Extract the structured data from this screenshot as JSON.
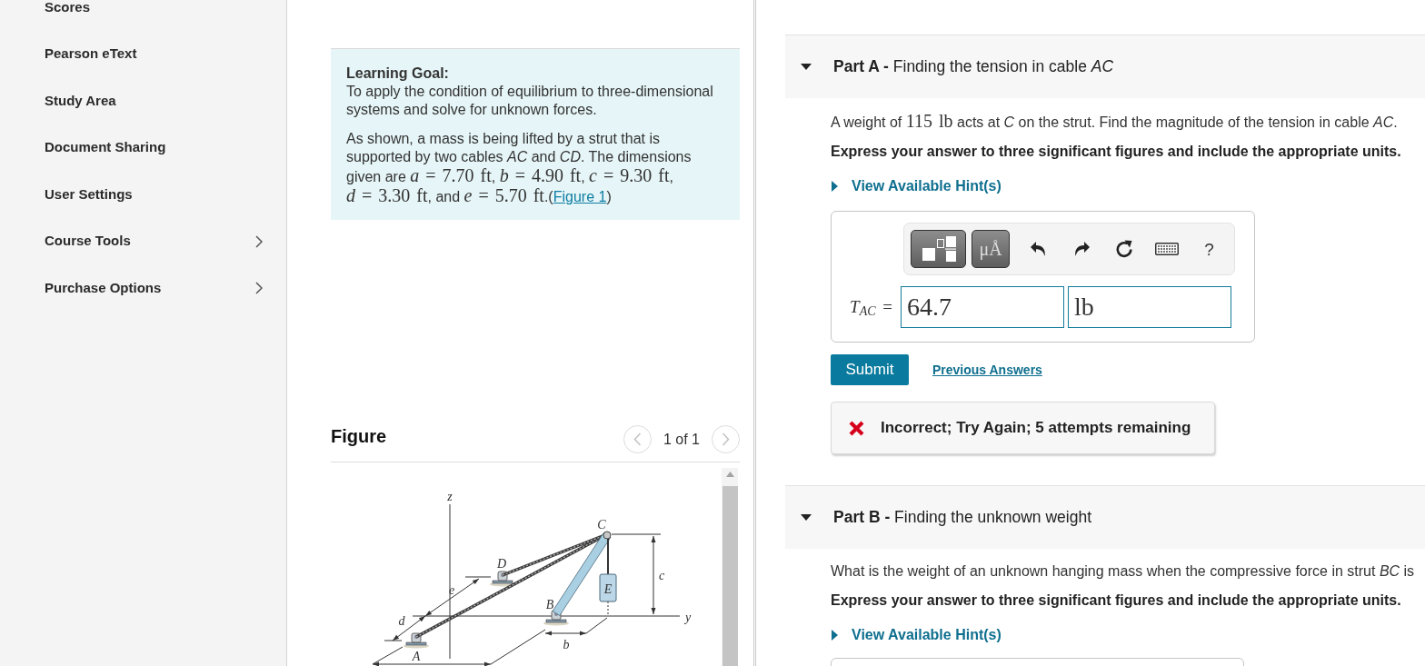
{
  "sidebar": {
    "items": [
      {
        "label": "Scores",
        "has_submenu": false,
        "selected": false
      },
      {
        "label": "Pearson eText",
        "has_submenu": false,
        "selected": false
      },
      {
        "label": "Study Area",
        "has_submenu": false,
        "selected": false
      },
      {
        "label": "Document Sharing",
        "has_submenu": false,
        "selected": false
      },
      {
        "label": "User Settings",
        "has_submenu": false,
        "selected": false
      },
      {
        "label": "Course Tools",
        "has_submenu": true,
        "selected": false
      },
      {
        "label": "Purchase Options",
        "has_submenu": true,
        "selected": false
      }
    ]
  },
  "intro": {
    "heading": "Learning Goal:",
    "goal": "To apply the condition of equilibrium to three-dimensional systems and solve for unknown forces.",
    "description": [
      {
        "kind": "text",
        "text": "As shown, a mass is being lifted by a strut that is supported by two cables *AC* and *CD*. The dimensions given are "
      },
      {
        "kind": "math",
        "text": "*a* = 7.70 ft"
      },
      {
        "kind": "text",
        "text": ", "
      },
      {
        "kind": "math",
        "text": "*b* = 4.90 ft"
      },
      {
        "kind": "text",
        "text": ", "
      },
      {
        "kind": "math",
        "text": "*c* = 9.30 ft"
      },
      {
        "kind": "text",
        "text": ", "
      },
      {
        "kind": "math",
        "text": "*d* = 3.30 ft"
      },
      {
        "kind": "text",
        "text": ", and "
      },
      {
        "kind": "math",
        "text": "*e* = 5.70 ft"
      },
      {
        "kind": "text",
        "text": ".("
      },
      {
        "kind": "link",
        "text": "Figure 1"
      },
      {
        "kind": "text",
        "text": ")"
      }
    ]
  },
  "figure": {
    "heading": "Figure",
    "pager": {
      "text": "1 of 1",
      "previous_disabled": true,
      "next_disabled": true
    },
    "axis_labels": [
      "z",
      "y"
    ],
    "point_labels": [
      "A",
      "B",
      "C",
      "D",
      "E"
    ],
    "dimension_labels": [
      "b",
      "c",
      "d",
      "e"
    ]
  },
  "parts": [
    {
      "title": "**Part A -** Finding the tension in cable *AC*",
      "expanded": true,
      "question": [
        {
          "kind": "text",
          "text": "A weight of "
        },
        {
          "kind": "math",
          "text": "115 lb"
        },
        {
          "kind": "text",
          "text": " acts at *C* on the strut. Find the magnitude of the tension in cable *AC*."
        }
      ],
      "instruction": "Express your answer to three significant figures and include the appropriate units.",
      "hints": {
        "label": "View Available Hint(s)",
        "expanded": false
      },
      "answer": {
        "toolbar": {
          "units_button": "μÅ",
          "help_button": "?"
        },
        "variable": "*T*$_{AC}$ =",
        "value": "64.7",
        "units": "lb"
      },
      "submit": "Submit",
      "previous_answers": "Previous Answers",
      "feedback": {
        "kind": "incorrect",
        "text": "Incorrect; Try Again; 5 attempts remaining"
      }
    },
    {
      "title": "**Part B -** Finding the unknown weight",
      "expanded": true,
      "question": [
        {
          "kind": "text",
          "text": "What is the weight of an unknown hanging mass when the compressive force in strut *BC* is"
        }
      ],
      "instruction": "Express your answer to three significant figures and include the appropriate units.",
      "hints": {
        "label": "View Available Hint(s)",
        "expanded": false
      }
    }
  ]
}
